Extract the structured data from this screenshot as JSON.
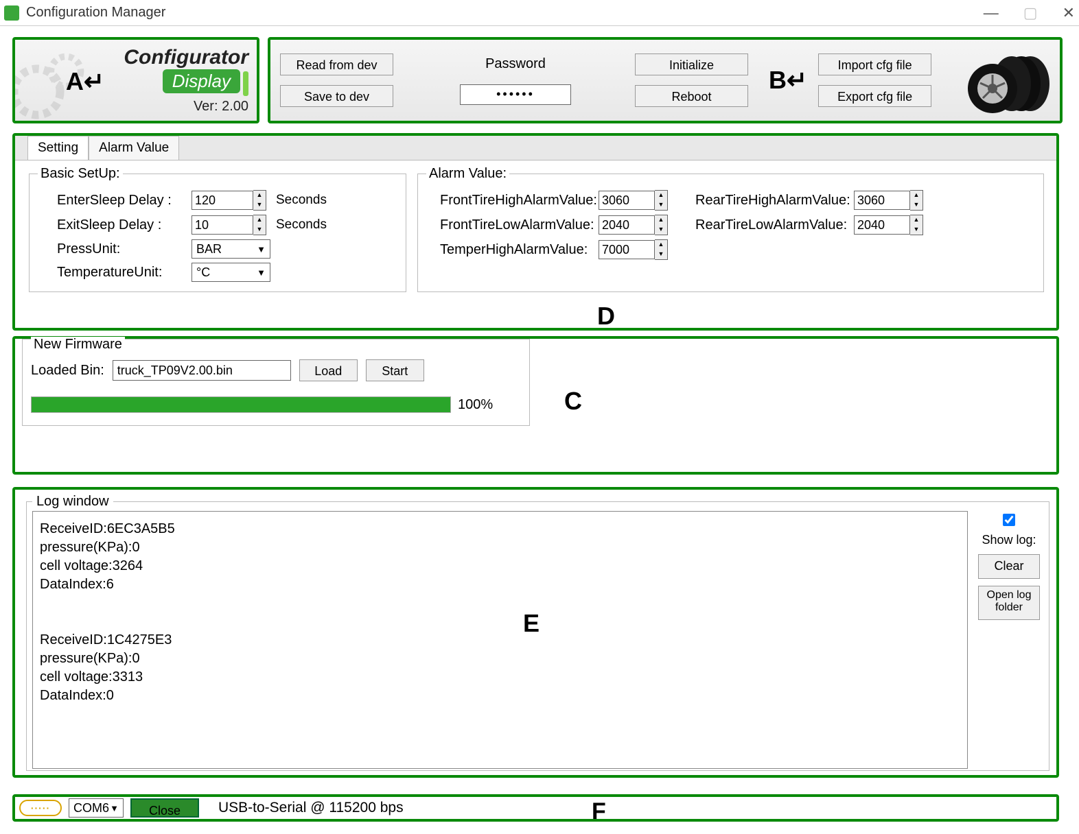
{
  "window": {
    "title": "Configuration Manager"
  },
  "regionA": {
    "annotation": "A↵",
    "title": "Configurator",
    "display": "Display",
    "version": "Ver: 2.00"
  },
  "regionB": {
    "annotation": "B↵",
    "read_btn": "Read from dev",
    "save_btn": "Save to dev",
    "password_label": "Password",
    "password_value": "••••••",
    "init_btn": "Initialize",
    "reboot_btn": "Reboot",
    "import_btn": "Import cfg file",
    "export_btn": "Export cfg file"
  },
  "tabs": {
    "setting": "Setting",
    "alarm": "Alarm Value"
  },
  "basic": {
    "legend": "Basic SetUp:",
    "enter_sleep_label": "EnterSleep Delay :",
    "enter_sleep_value": "120",
    "exit_sleep_label": "ExitSleep Delay :",
    "exit_sleep_value": "10",
    "seconds": "Seconds",
    "press_unit_label": "PressUnit:",
    "press_unit_value": "BAR",
    "temp_unit_label": "TemperatureUnit:",
    "temp_unit_value": "°C"
  },
  "alarm": {
    "legend": "Alarm Value:",
    "front_high_label": "FrontTireHighAlarmValue:",
    "front_high_value": "3060",
    "front_low_label": "FrontTireLowAlarmValue:",
    "front_low_value": "2040",
    "temp_high_label": "TemperHighAlarmValue:",
    "temp_high_value": "7000",
    "rear_high_label": "RearTireHighAlarmValue:",
    "rear_high_value": "3060",
    "rear_low_label": "RearTireLowAlarmValue:",
    "rear_low_value": "2040",
    "annotation": "D"
  },
  "firmware": {
    "legend": "New Firmware",
    "loaded_label": "Loaded Bin:",
    "loaded_value": "truck_TP09V2.00.bin",
    "load_btn": "Load",
    "start_btn": "Start",
    "progress_percent": "100%",
    "annotation": "C"
  },
  "log": {
    "legend": "Log window",
    "content": "ReceiveID:6EC3A5B5\npressure(KPa):0\ncell voltage:3264\nDataIndex:6\n\n\nReceiveID:1C4275E3\npressure(KPa):0\ncell voltage:3313\nDataIndex:0",
    "show_log_label": "Show log:",
    "show_log_checked": true,
    "clear_btn": "Clear",
    "open_folder_btn": "Open log folder",
    "annotation": "E"
  },
  "statusbar": {
    "com_port": "COM6",
    "close_btn": "Close",
    "conn_text": "USB-to-Serial @ 115200 bps",
    "annotation": "F"
  }
}
